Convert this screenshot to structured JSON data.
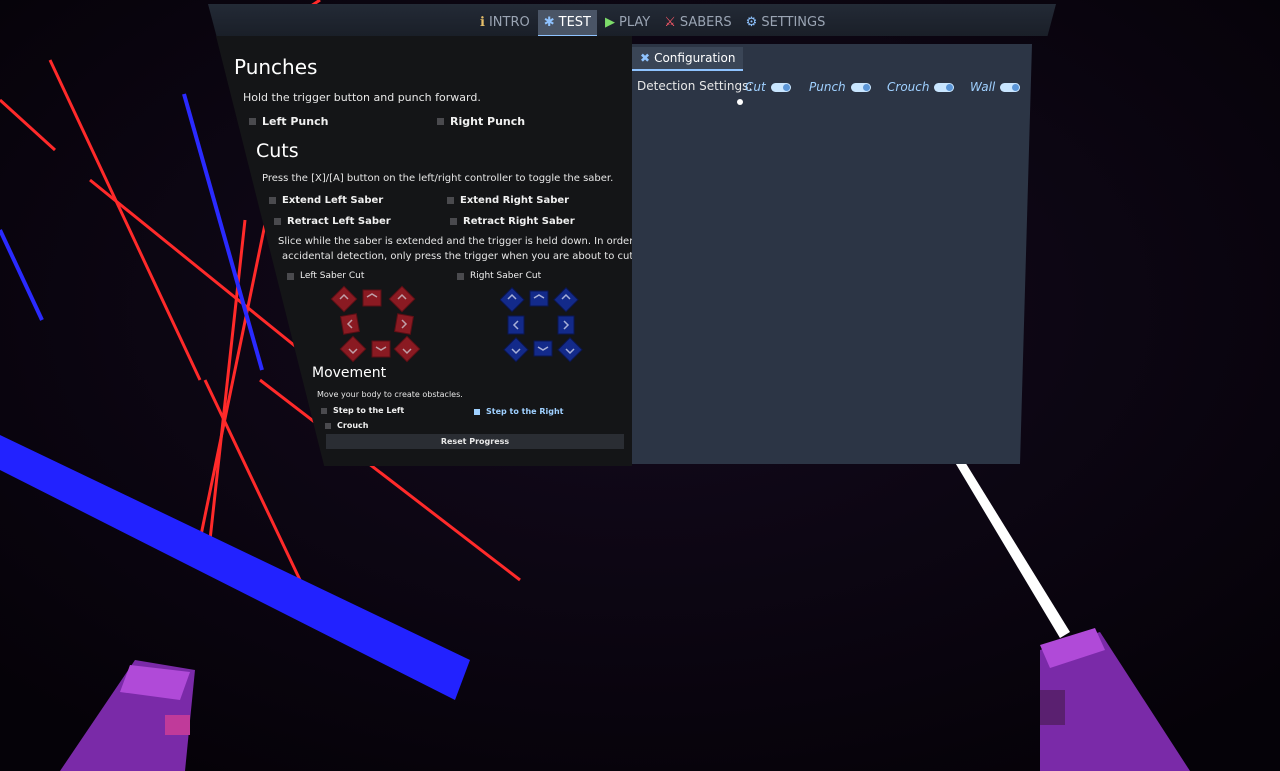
{
  "tabs": [
    {
      "label": "INTRO",
      "icon": "info-icon"
    },
    {
      "label": "TEST",
      "icon": "figure-icon"
    },
    {
      "label": "PLAY",
      "icon": "play-icon"
    },
    {
      "label": "SABERS",
      "icon": "saber-icon"
    },
    {
      "label": "SETTINGS",
      "icon": "gear-icon"
    }
  ],
  "punches": {
    "title": "Punches",
    "instruction": "Hold the trigger button and punch forward.",
    "left": "Left Punch",
    "right": "Right Punch"
  },
  "cuts": {
    "title": "Cuts",
    "instruction": "Press the [X]/[A] button on the left/right controller to toggle the saber.",
    "extend_left": "Extend Left Saber",
    "extend_right": "Extend Right Saber",
    "retract_left": "Retract Left Saber",
    "retract_right": "Retract Right Saber",
    "slice_line1": "Slice while the saber is extended and the trigger is held down. In order to avoid",
    "slice_line2": "accidental detection, only press the trigger when you are about to cut.",
    "left_cut": "Left Saber Cut",
    "right_cut": "Right Saber Cut"
  },
  "movement": {
    "title": "Movement",
    "instruction": "Move your body to create obstacles.",
    "step_left": "Step to the Left",
    "step_right": "Step to the Right",
    "crouch": "Crouch"
  },
  "reset_label": "Reset Progress",
  "config": {
    "tab_label": "Configuration",
    "detection_label": "Detection Settings:",
    "toggles": [
      {
        "label": "Cut",
        "on": true
      },
      {
        "label": "Punch",
        "on": true
      },
      {
        "label": "Crouch",
        "on": true
      },
      {
        "label": "Wall",
        "on": true
      }
    ]
  },
  "colors": {
    "accent": "#8fc3ff",
    "left_saber": "#e0202a",
    "right_saber": "#2020ff",
    "left_cube": "#8a1a22",
    "right_cube": "#132a8a",
    "controller": "#8a2fb5"
  }
}
